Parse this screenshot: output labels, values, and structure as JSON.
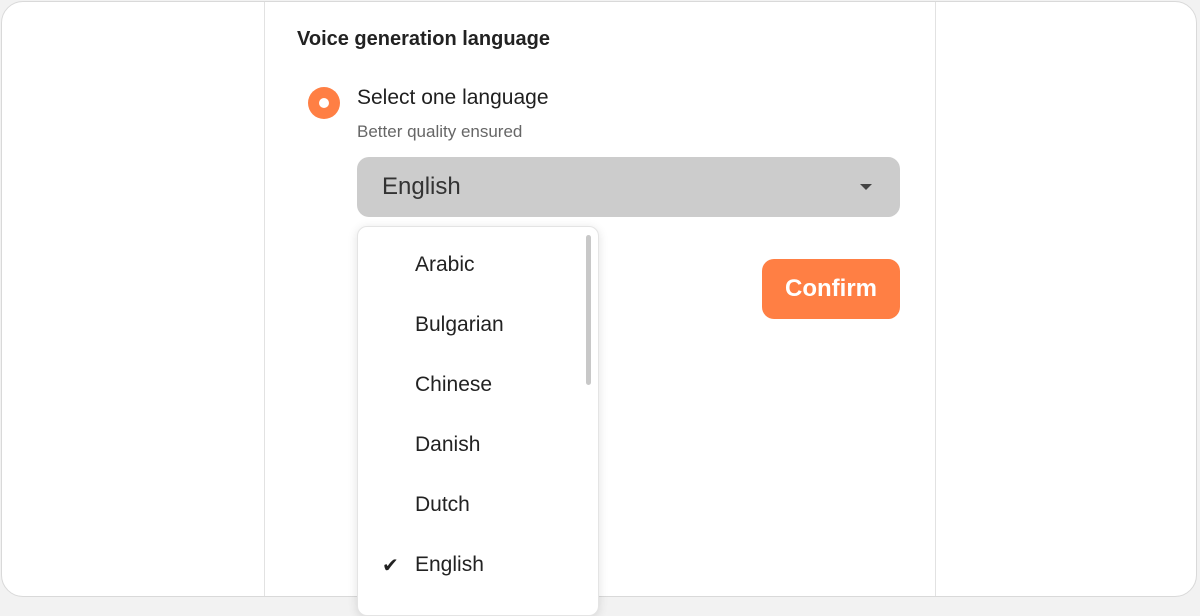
{
  "section": {
    "title": "Voice generation language"
  },
  "option": {
    "label": "Select one language",
    "sublabel": "Better quality ensured",
    "selected": true
  },
  "select": {
    "value": "English",
    "icon": "caret-down-icon"
  },
  "confirm_button": {
    "label": "Confirm"
  },
  "dropdown": {
    "items": [
      {
        "label": "Arabic",
        "checked": false
      },
      {
        "label": "Bulgarian",
        "checked": false
      },
      {
        "label": "Chinese",
        "checked": false
      },
      {
        "label": "Danish",
        "checked": false
      },
      {
        "label": "Dutch",
        "checked": false
      },
      {
        "label": "English",
        "checked": true
      }
    ],
    "check_icon": "checkmark-icon"
  },
  "colors": {
    "accent": "#ff7f44",
    "select_bg": "#cccccc"
  }
}
